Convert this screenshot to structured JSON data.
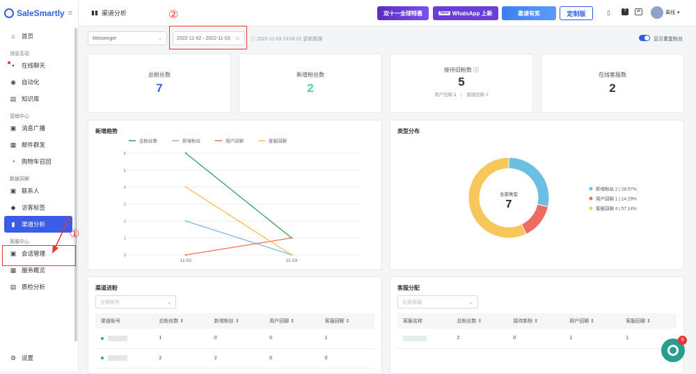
{
  "sidebar": {
    "logo": "SaleSmartly",
    "home": "首页",
    "group1": "消息互动",
    "chat": "在线聊天",
    "auto": "自动化",
    "kb": "知识库",
    "group2": "营销中心",
    "broadcast": "消息广播",
    "email": "邮件群发",
    "cart": "购物车召回",
    "group3": "数据洞察",
    "contacts": "联系人",
    "visitor_tags": "访客标签",
    "channel": "渠道分析",
    "group4": "客服中心",
    "sessions": "会话管理",
    "service": "服务概览",
    "qa": "质检分析",
    "settings": "设置"
  },
  "header": {
    "title": "渠道分析",
    "promo1": "双十一全球特惠",
    "promo2_badge": "New",
    "promo2": "WhatsApp 上新",
    "promo3": "邀请有奖",
    "custom": "定制版",
    "user": "离线"
  },
  "annotations": {
    "one": "①",
    "two": "②"
  },
  "filters": {
    "channel": "Messenger",
    "date_range": "2022-11-02 - 2022-11-03",
    "updated": "2022-11-03 13:08:01 更新数据",
    "toggle_label": "显示重复粉丝"
  },
  "kpis": [
    {
      "label": "总粉丝数",
      "value": "7",
      "color": "#3b5ce6"
    },
    {
      "label": "新增粉丝数",
      "value": "2",
      "color": "#4ecbb0"
    },
    {
      "label": "接待旧粉数 ⓘ",
      "value": "5",
      "color": "#333"
    },
    {
      "label": "在线客服数",
      "value": "2",
      "color": "#333"
    }
  ],
  "kpi_sub": {
    "a_label": "用户回聊",
    "a_val": "1",
    "b_label": "客服回聊",
    "b_val": "4"
  },
  "trend": {
    "title": "新增趋势"
  },
  "donut": {
    "title": "类型分布",
    "center_label": "全部类型",
    "center_value": "7",
    "legend": [
      "新增粉丝 2 | 28.57%",
      "用户回聊 1 | 14.29%",
      "客服回聊 4 | 57.14%"
    ]
  },
  "channel_table": {
    "title": "渠道进粉",
    "filter": "全部账号",
    "headers": [
      "渠道账号",
      "总粉丝数 ⇕",
      "新增粉丝 ⇕",
      "用户回聊 ⇕",
      "客服回聊 ⇕"
    ],
    "rows": [
      [
        "",
        "1",
        "0",
        "0",
        "1"
      ],
      [
        "",
        "2",
        "2",
        "0",
        "0"
      ]
    ]
  },
  "agent_table": {
    "title": "客服分配",
    "filter": "全部客服",
    "headers": [
      "客服名称",
      "总粉丝数 ⇕",
      "接待新粉 ⇕",
      "用户回聊 ⇕",
      "客服回聊 ⇕"
    ],
    "rows": [
      [
        "",
        "2",
        "0",
        "1",
        "1"
      ]
    ]
  },
  "chat_badge": "9",
  "chart_data": [
    {
      "type": "line",
      "title": "新增趋势",
      "categories": [
        "11-02",
        "11-03"
      ],
      "ylim": [
        0,
        6
      ],
      "series": [
        {
          "name": "总粉丝数",
          "values": [
            6,
            1
          ],
          "color": "#2e9e6b"
        },
        {
          "name": "新增粉丝",
          "values": [
            2,
            0
          ],
          "color": "#7fb7e6"
        },
        {
          "name": "用户回聊",
          "values": [
            0,
            1
          ],
          "color": "#f0705a"
        },
        {
          "name": "客服回聊",
          "values": [
            4,
            0
          ],
          "color": "#f5c04e"
        }
      ]
    },
    {
      "type": "pie",
      "title": "类型分布",
      "categories": [
        "新增粉丝",
        "用户回聊",
        "客服回聊"
      ],
      "values": [
        2,
        1,
        4
      ],
      "colors": [
        "#6bbfe3",
        "#ee6b62",
        "#f8c75a"
      ]
    }
  ]
}
